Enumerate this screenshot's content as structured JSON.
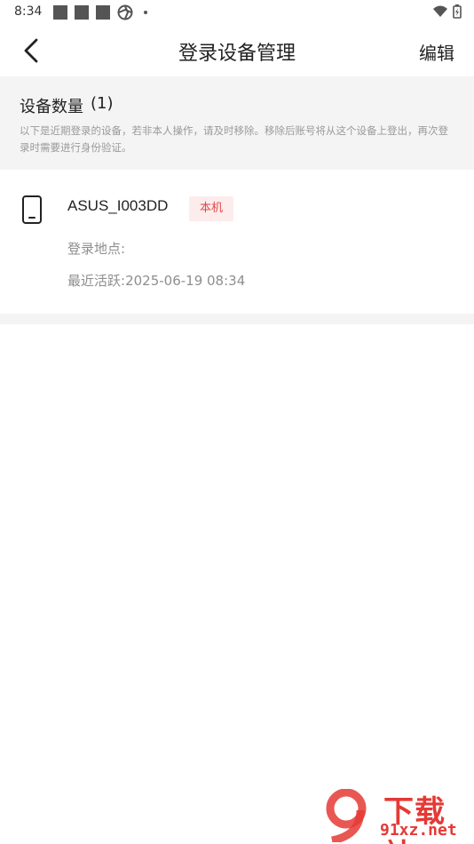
{
  "status_bar": {
    "time": "8:34"
  },
  "header": {
    "title": "登录设备管理",
    "edit_label": "编辑"
  },
  "info": {
    "count_label": "设备数量",
    "count_value": "(1)",
    "description": "以下是近期登录的设备，若非本人操作，请及时移除。移除后账号将从这个设备上登出，再次登录时需要进行身份验证。"
  },
  "device": {
    "icon": "phone-icon",
    "name": "ASUS_I003DD",
    "badge": "本机",
    "location_label": "登录地点:",
    "location_value": "",
    "active_label": "最近活跃:",
    "active_value": "2025-06-19 08:34"
  },
  "watermark": {
    "title": "下载站",
    "site": "91xz.net"
  },
  "colors": {
    "accent": "#e04848",
    "badge_bg": "#fdecec",
    "section_bg": "#f4f4f4"
  }
}
